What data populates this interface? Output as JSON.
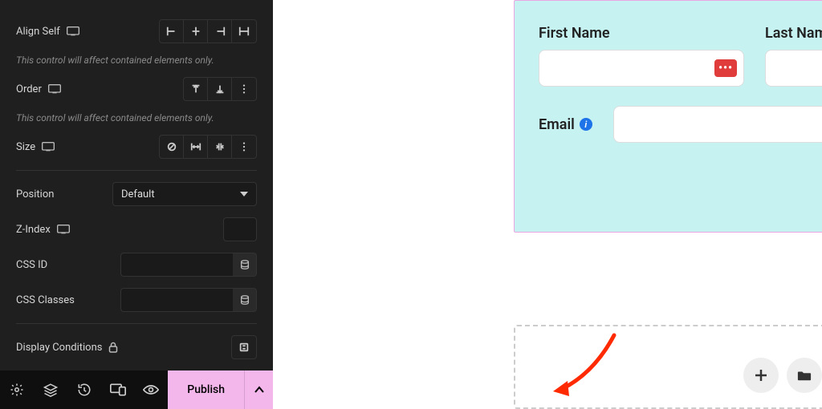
{
  "sidebar": {
    "alignSelf": {
      "label": "Align Self"
    },
    "hint1": "This control will affect contained elements only.",
    "order": {
      "label": "Order"
    },
    "hint2": "This control will affect contained elements only.",
    "size": {
      "label": "Size"
    },
    "position": {
      "label": "Position",
      "value": "Default"
    },
    "zindex": {
      "label": "Z-Index",
      "value": ""
    },
    "cssid": {
      "label": "CSS ID",
      "value": ""
    },
    "cssclasses": {
      "label": "CSS Classes",
      "value": ""
    },
    "displayCond": {
      "label": "Display Conditions"
    }
  },
  "bottom": {
    "publish": "Publish"
  },
  "form": {
    "firstName": "First Name",
    "lastName": "Last Name",
    "email": "Email",
    "extBadge": "•••"
  }
}
